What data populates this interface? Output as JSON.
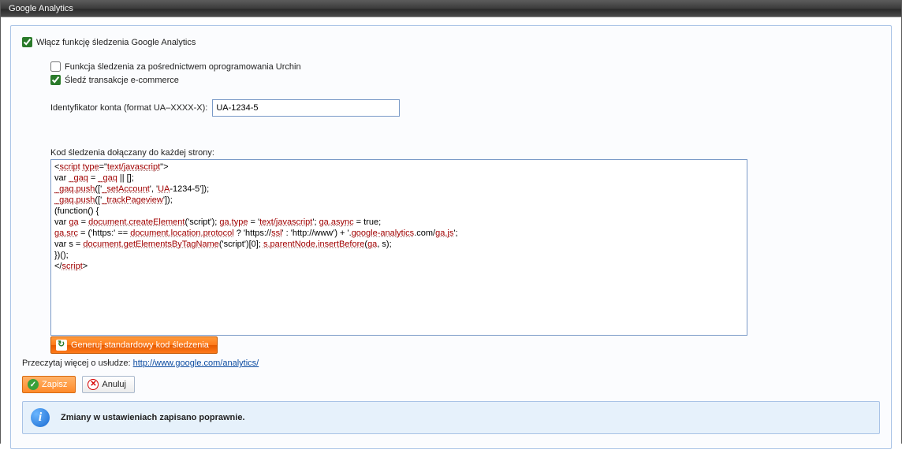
{
  "window": {
    "title": "Google Analytics"
  },
  "checkboxes": {
    "enable": {
      "label": "Włącz funkcję śledzenia Google Analytics",
      "checked": true
    },
    "urchin": {
      "label": "Funkcja śledzenia za pośrednictwem oprogramowania Urchin",
      "checked": false
    },
    "ecommerce": {
      "label": "Śledź transakcje e-commerce",
      "checked": true
    }
  },
  "account": {
    "label": "Identyfikator konta (format UA–XXXX-X):",
    "value": "UA-1234-5"
  },
  "code": {
    "label": "Kod śledzenia dołączany do każdej strony:",
    "lines": {
      "l1a": "<",
      "l1b": "script",
      "l1c": "type",
      "l1d": "=\"",
      "l1e": "text/javascript",
      "l1f": "\">",
      "l2a": "var ",
      "l2b": "_gaq",
      "l2c": " = ",
      "l2d": "_gaq",
      "l2e": " || [];",
      "l3a": "_gaq.push",
      "l3b": "(['",
      "l3c": "_setAccount",
      "l3d": "', '",
      "l3e": "UA",
      "l3f": "-1234-5']);",
      "l4a": "_gaq.push",
      "l4b": "(['",
      "l4c": "_trackPageview",
      "l4d": "']);",
      "l5": "(function() {",
      "l6a": "var ",
      "l6b": "ga",
      "l6c": " = ",
      "l6d": "document.createElement",
      "l6e": "('script'); ",
      "l6f": "ga.type",
      "l6g": " = '",
      "l6h": "text/javascript",
      "l6i": "'; ",
      "l6j": "ga.async",
      "l6k": " = true;",
      "l7a": "ga.src",
      "l7b": " = ('https:' == ",
      "l7c": "document.location.protocol",
      "l7d": " ? 'https://",
      "l7e": "ssl",
      "l7f": "' : 'http://www') + '.",
      "l7g": "google-analytics",
      "l7h": ".com/",
      "l7i": "ga.js",
      "l7j": "';",
      "l8a": "var s = ",
      "l8b": "document.getElementsByTagName",
      "l8c": "('script')[0]; ",
      "l8d": "s.parentNode.insertBefore",
      "l8e": "(",
      "l8f": "ga",
      "l8g": ", s);",
      "l9": "})();",
      "l10a": "</",
      "l10b": "script",
      "l10c": ">"
    },
    "generate_button": "Generuj standardowy kod śledzenia"
  },
  "readmore": {
    "prefix": "Przeczytaj więcej o usłudze: ",
    "url_text": "http://www.google.com/analytics/"
  },
  "actions": {
    "save": "Zapisz",
    "cancel": "Anuluj"
  },
  "status": {
    "message": "Zmiany w ustawieniach zapisano poprawnie."
  }
}
